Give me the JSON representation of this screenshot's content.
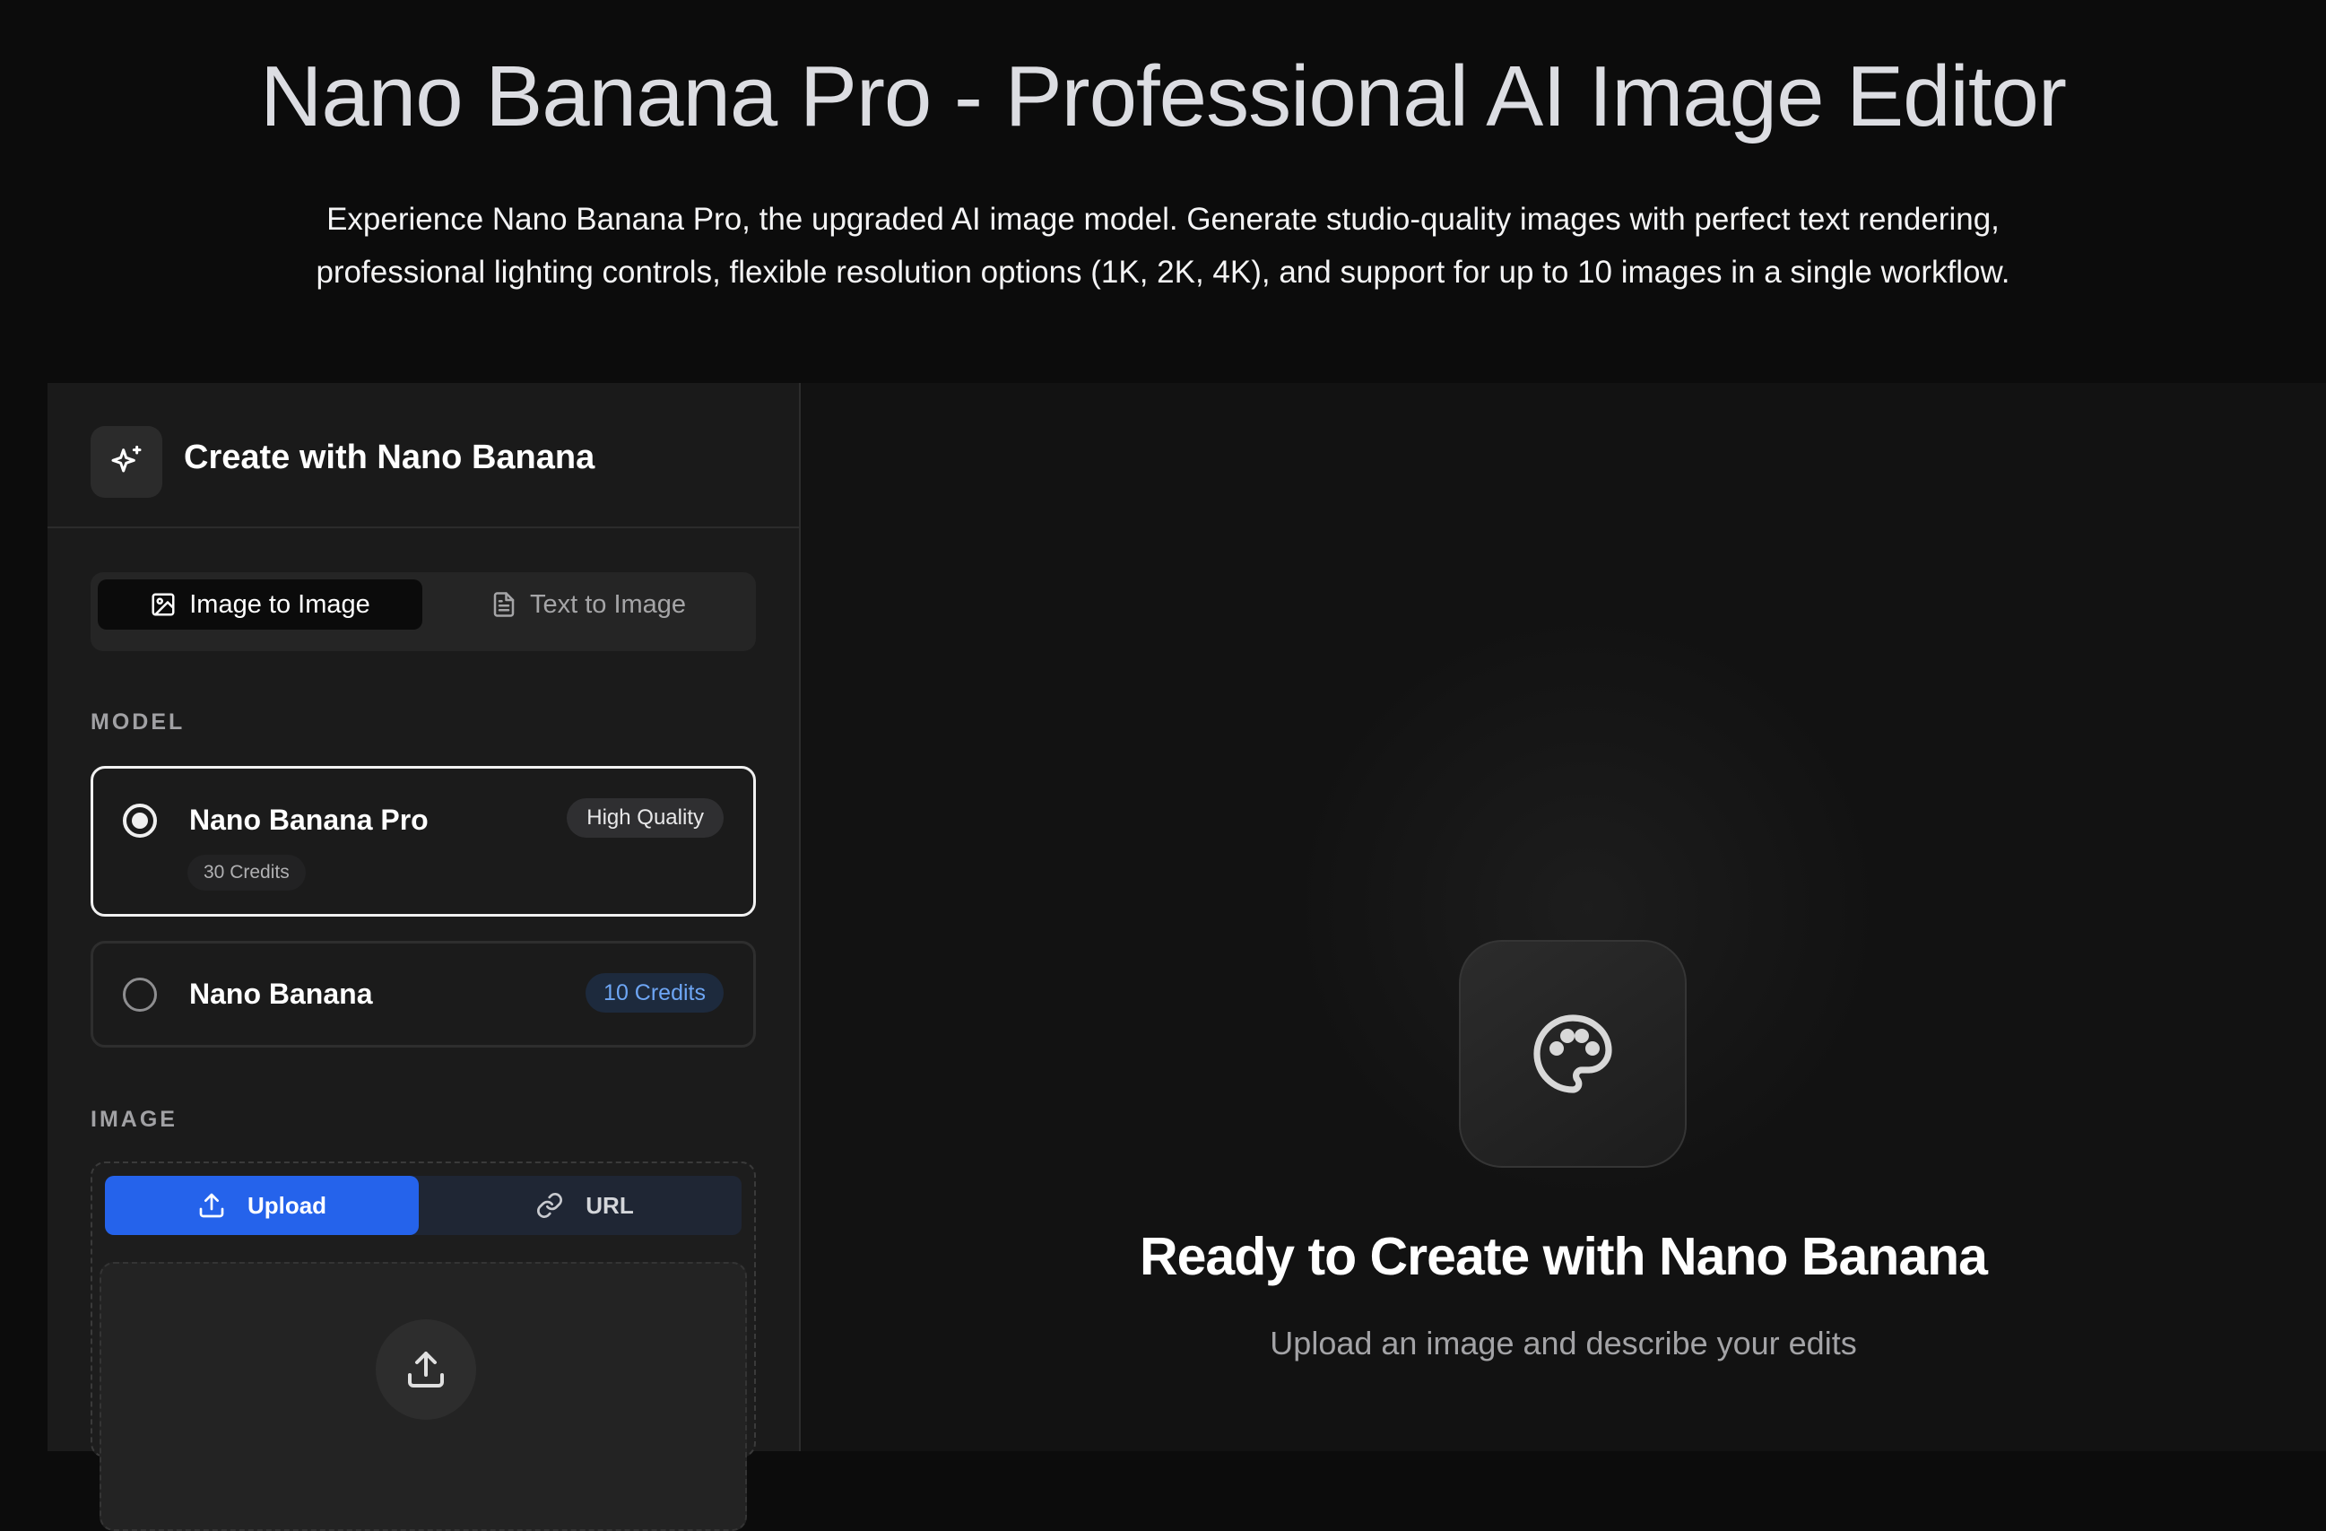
{
  "hero": {
    "title": "Nano Banana Pro - Professional AI Image Editor",
    "description_line1": "Experience Nano Banana Pro, the upgraded AI image model. Generate studio-quality images with perfect text rendering,",
    "description_line2": "professional lighting controls, flexible resolution options (1K, 2K, 4K), and support for up to 10 images in a single workflow."
  },
  "panel": {
    "title": "Create with Nano Banana",
    "header_icon": "sparkles-icon",
    "tabs": [
      {
        "label": "Image to Image",
        "icon": "image-icon",
        "active": true
      },
      {
        "label": "Text to Image",
        "icon": "document-icon",
        "active": false
      }
    ],
    "model_section_label": "MODEL",
    "models": [
      {
        "name": "Nano Banana Pro",
        "badge": "High Quality",
        "credits": "30 Credits",
        "selected": true
      },
      {
        "name": "Nano Banana",
        "credits": "10 Credits",
        "selected": false
      }
    ],
    "image_section_label": "IMAGE",
    "source_tabs": [
      {
        "label": "Upload",
        "icon": "upload-icon",
        "active": true
      },
      {
        "label": "URL",
        "icon": "link-icon",
        "active": false
      }
    ],
    "dropzone_icon": "upload-icon"
  },
  "canvas": {
    "icon": "palette-icon",
    "title": "Ready to Create with Nano Banana",
    "subtitle": "Upload an image and describe your edits"
  },
  "colors": {
    "background": "#0c0c0c",
    "panel": "#1b1b1b",
    "accent_blue": "#2563eb",
    "credits_blue": "#6ea6f5"
  }
}
